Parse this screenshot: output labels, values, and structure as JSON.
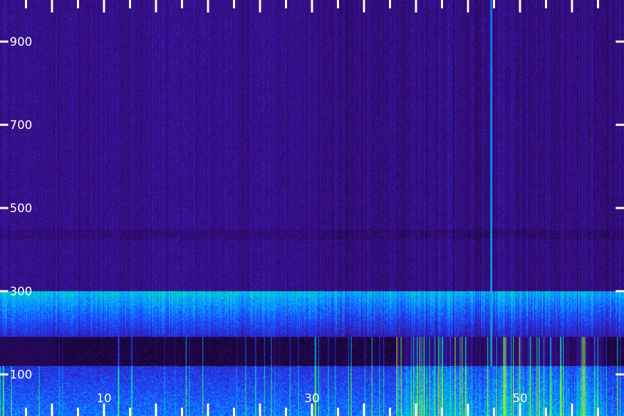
{
  "chart_data": {
    "type": "heatmap",
    "title": "",
    "xlabel": "",
    "ylabel": "",
    "x_ticks": [
      10,
      30,
      50
    ],
    "x_minor_step": 2.5,
    "xlim": [
      0,
      60
    ],
    "y_ticks": [
      100,
      300,
      500,
      700,
      900
    ],
    "ylim": [
      0,
      1000
    ],
    "grid": false,
    "legend": "none",
    "colormap": [
      "#000000",
      "#2b0a66",
      "#3a1090",
      "#1f3fff",
      "#00b8ff",
      "#00ff66",
      "#c8ff00"
    ],
    "features": [
      {
        "kind": "band",
        "y_range": [
          190,
          300
        ],
        "level": 0.62
      },
      {
        "kind": "band",
        "y_range": [
          120,
          190
        ],
        "level": 0.0
      },
      {
        "kind": "band",
        "y_range": [
          0,
          120
        ],
        "level": 0.75
      },
      {
        "kind": "line",
        "x": 47.2,
        "y_range": [
          120,
          1000
        ],
        "level": 1.0
      },
      {
        "kind": "bursts",
        "x_range": [
          38,
          58
        ],
        "y_range": [
          0,
          190
        ],
        "level": 0.9
      }
    ]
  }
}
